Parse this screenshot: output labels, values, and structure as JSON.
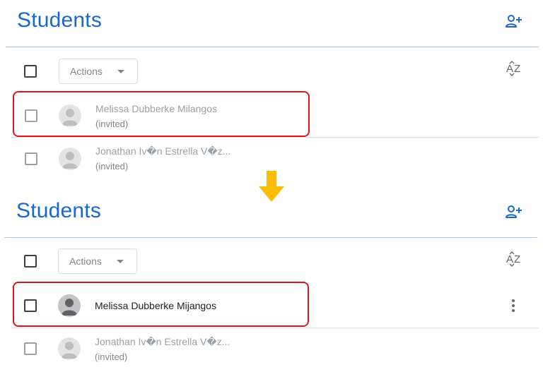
{
  "top": {
    "title": "Students",
    "actions_label": "Actions",
    "students": [
      {
        "name": "Melissa Dubberke Milangos",
        "status": "(invited)"
      },
      {
        "name": "Jonathan Iv�n Estrella V�z...",
        "status": "(invited)"
      }
    ]
  },
  "bottom": {
    "title": "Students",
    "actions_label": "Actions",
    "students": [
      {
        "name": "Melissa Dubberke Mijangos"
      },
      {
        "name": "Jonathan Iv�n Estrella V�z...",
        "status": "(invited)"
      }
    ]
  },
  "colors": {
    "title": "#1967d2",
    "highlight": "#e0151b",
    "arrow": "#fbbc04"
  },
  "icons": {
    "add_student": "person-add-icon",
    "sort": "sort-az-icon",
    "more": "more-vert-icon",
    "transition": "arrow-down-icon"
  }
}
